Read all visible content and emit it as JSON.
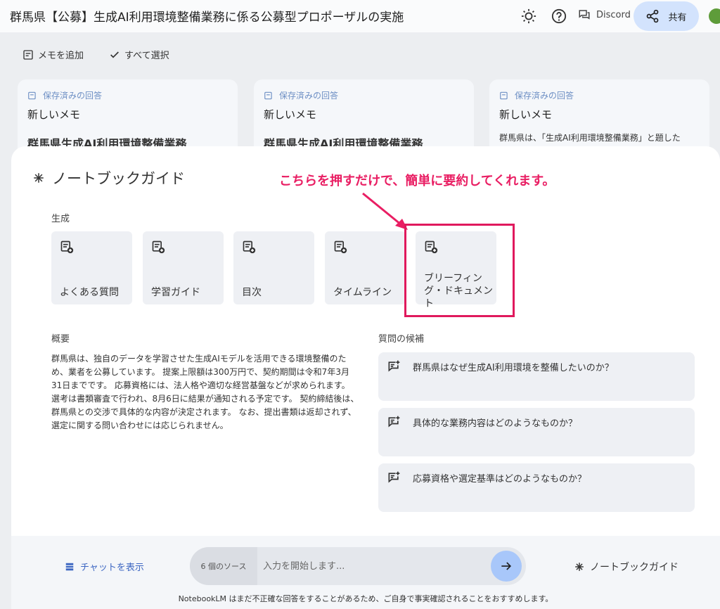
{
  "header": {
    "title": "群馬県【公募】生成AI利用環境整備業務に係る公募型プロポーザルの実施",
    "discord_label": "Discord",
    "share_label": "共有"
  },
  "toolbar": {
    "add_memo": "メモを追加",
    "select_all": "すべて選択"
  },
  "memos": [
    {
      "saved": "保存済みの回答",
      "title": "新しいメモ",
      "body": "群馬県生成AI利用環境整備業務"
    },
    {
      "saved": "保存済みの回答",
      "title": "新しいメモ",
      "body": "群馬県生成AI利用環境整備業務"
    },
    {
      "saved": "保存済みの回答",
      "title": "新しいメモ",
      "body": "群馬県は、「生成AI利用環境整備業務」と題した"
    }
  ],
  "guide": {
    "title": "ノートブックガイド",
    "annotation": "こちらを押すだけで、簡単に要約してくれます。",
    "generate_label": "生成",
    "generate_items": [
      "よくある質問",
      "学習ガイド",
      "目次",
      "タイムライン",
      "ブリーフィング・ドキュメント"
    ],
    "summary_title": "概要",
    "summary_text": "群馬県は、独自のデータを学習させた生成AIモデルを活用できる環境整備のため、業者を公募しています。 提案上限額は300万円で、契約期間は令和7年3月31日までです。 応募資格には、法人格や適切な経営基盤などが求められます。 選考は書類審査で行われ、8月6日に結果が通知される予定です。 契約締結後は、群馬県との交渉で具体的な内容が決定されます。 なお、提出書類は返却されず、選定に関する問い合わせには応じられません。",
    "questions_title": "質問の候補",
    "questions": [
      "群馬県はなぜ生成AI利用環境を整備したいのか？",
      "具体的な業務内容はどのようなものか？",
      "応募資格や選定基準はどのようなものか？"
    ]
  },
  "bottom": {
    "show_chat": "チャットを表示",
    "sources": "6 個のソース",
    "input_placeholder": "入力を開始します...",
    "notebook_guide": "ノートブックガイド",
    "disclaimer": "NotebookLM はまだ不正確な回答をすることがあるため、ご自身で事実確認されることをおすすめします。"
  },
  "colors": {
    "accent": "#d3e3fd",
    "annotation": "#e91e63",
    "link": "#3c66c2"
  }
}
